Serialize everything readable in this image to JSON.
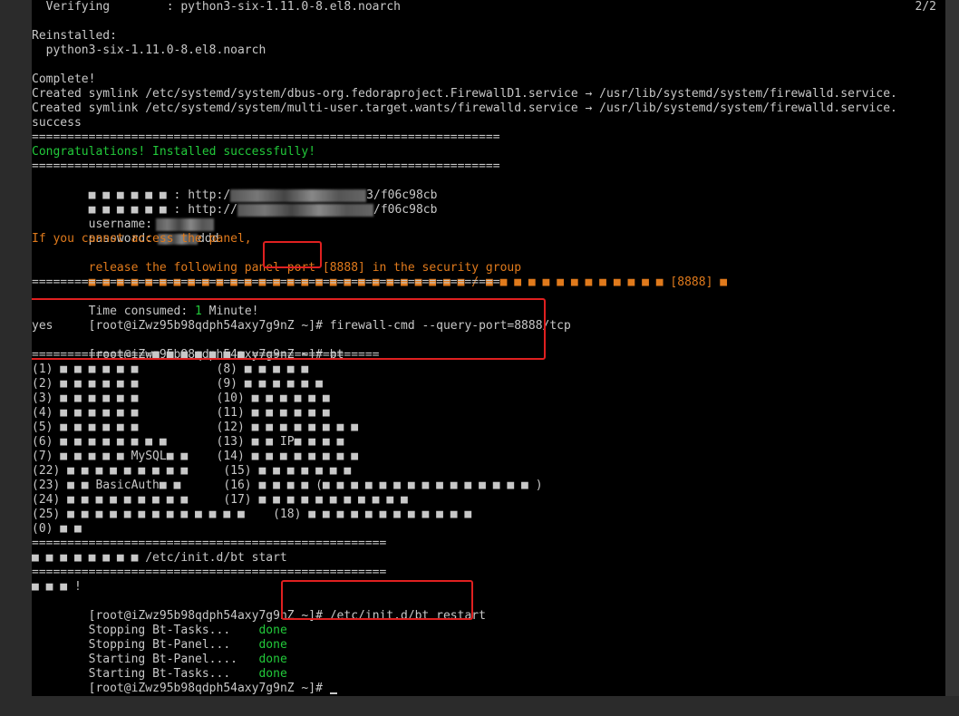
{
  "terminal": {
    "page_indicator": "2/2",
    "prompt": "[root@iZwz95b98qdph54axy7g9nZ ~]#",
    "lines": {
      "verifying": "  Verifying        : python3-six-1.11.0-8.el8.noarch",
      "reinstalled": "Reinstalled:",
      "reinstalled_pkg": "  python3-six-1.11.0-8.el8.noarch",
      "complete": "Complete!",
      "symlink1": "Created symlink /etc/systemd/system/dbus-org.fedoraproject.FirewallD1.service → /usr/lib/systemd/system/firewalld.service.",
      "symlink2": "Created symlink /etc/systemd/system/multi-user.target.wants/firewalld.service → /usr/lib/systemd/system/firewalld.service.",
      "success": "success",
      "sep_long": "==================================================================",
      "congrats": "Congratulations! Installed successfully!",
      "url1_prefix": "■ ■ ■ ■ ■ ■ : http:/",
      "url1_suffix": "3/f06c98cb",
      "url2_prefix": "■ ■ ■ ■ ■ ■ : http://",
      "url2_suffix": "/f06c98cb",
      "username_label": "username:",
      "password_label": "password:",
      "password_tail": "ddd",
      "panel_warn1": "If you cannot access the panel,",
      "panel_warn2_pre": "release the following panel port ",
      "panel_port": "[8888]",
      "panel_warn2_post": " in the security group",
      "port_line_pre": "■ ■ ■ ■ ■ ■ ■ ■ ■ ■ ■ ■ ■ ■ ■ ■ ■ ■ ■ ■ ■ ■ ■ ■ ■ ■ ■",
      "port_line_mid": " / ",
      "port_line_post": "■ ■ ■ ■ ■ ■ ■ ■ ■ ■ ■ ■ ■ [8888] ■",
      "time_consumed_pre": "Time consumed: ",
      "time_consumed_num": "1",
      "time_consumed_post": " Minute!",
      "cmd1": " firewall-cmd --query-port=8888/tcp",
      "yes": "yes",
      "cmd2": " bt",
      "menu_sep": "=================■ ■ ■ ■ ■ ■ ■ ==================",
      "menu_1": "(1) ■ ■ ■ ■ ■ ■           (8) ■ ■ ■ ■ ■",
      "menu_2": "(2) ■ ■ ■ ■ ■ ■           (9) ■ ■ ■ ■ ■ ■",
      "menu_3": "(3) ■ ■ ■ ■ ■ ■           (10) ■ ■ ■ ■ ■ ■",
      "menu_4": "(4) ■ ■ ■ ■ ■ ■           (11) ■ ■ ■ ■ ■ ■",
      "menu_5": "(5) ■ ■ ■ ■ ■ ■           (12) ■ ■ ■ ■ ■ ■ ■ ■",
      "menu_6": "(6) ■ ■ ■ ■ ■ ■ ■ ■       (13) ■ ■ IP■ ■ ■ ■",
      "menu_7": "(7) ■ ■ ■ ■ ■ MySQL■ ■    (14) ■ ■ ■ ■ ■ ■ ■ ■",
      "menu_22": "(22) ■ ■ ■ ■ ■ ■ ■ ■ ■     (15) ■ ■ ■ ■ ■ ■ ■",
      "menu_23": "(23) ■ ■ BasicAuth■ ■      (16) ■ ■ ■ ■ (■ ■ ■ ■ ■ ■ ■ ■ ■ ■ ■ ■ ■ ■ ■ )",
      "menu_24": "(24) ■ ■ ■ ■ ■ ■ ■ ■ ■     (17) ■ ■ ■ ■ ■ ■ ■ ■ ■ ■ ■",
      "menu_25": "(25) ■ ■ ■ ■ ■ ■ ■ ■ ■ ■ ■ ■ ■    (18) ■ ■ ■ ■ ■ ■ ■ ■ ■ ■ ■ ■",
      "menu_0": "(0) ■ ■",
      "sep_short": "==================================================",
      "bt_start": "■ ■ ■ ■ ■ ■ ■ ■ /etc/init.d/bt start",
      "exclaim": "■ ■ ■ !",
      "cmd3": " /etc/init.d/bt restart",
      "stop_tasks": "Stopping Bt-Tasks...    ",
      "stop_panel": "Stopping Bt-Panel...    ",
      "start_panel": "Starting Bt-Panel....   ",
      "start_tasks": "Starting Bt-Tasks...    ",
      "done": "done"
    }
  },
  "colors": {
    "background": "#000000",
    "text": "#c8c8c8",
    "success_green": "#22c93a",
    "warning_orange": "#e07a1c",
    "highlight_red": "#e02020"
  }
}
